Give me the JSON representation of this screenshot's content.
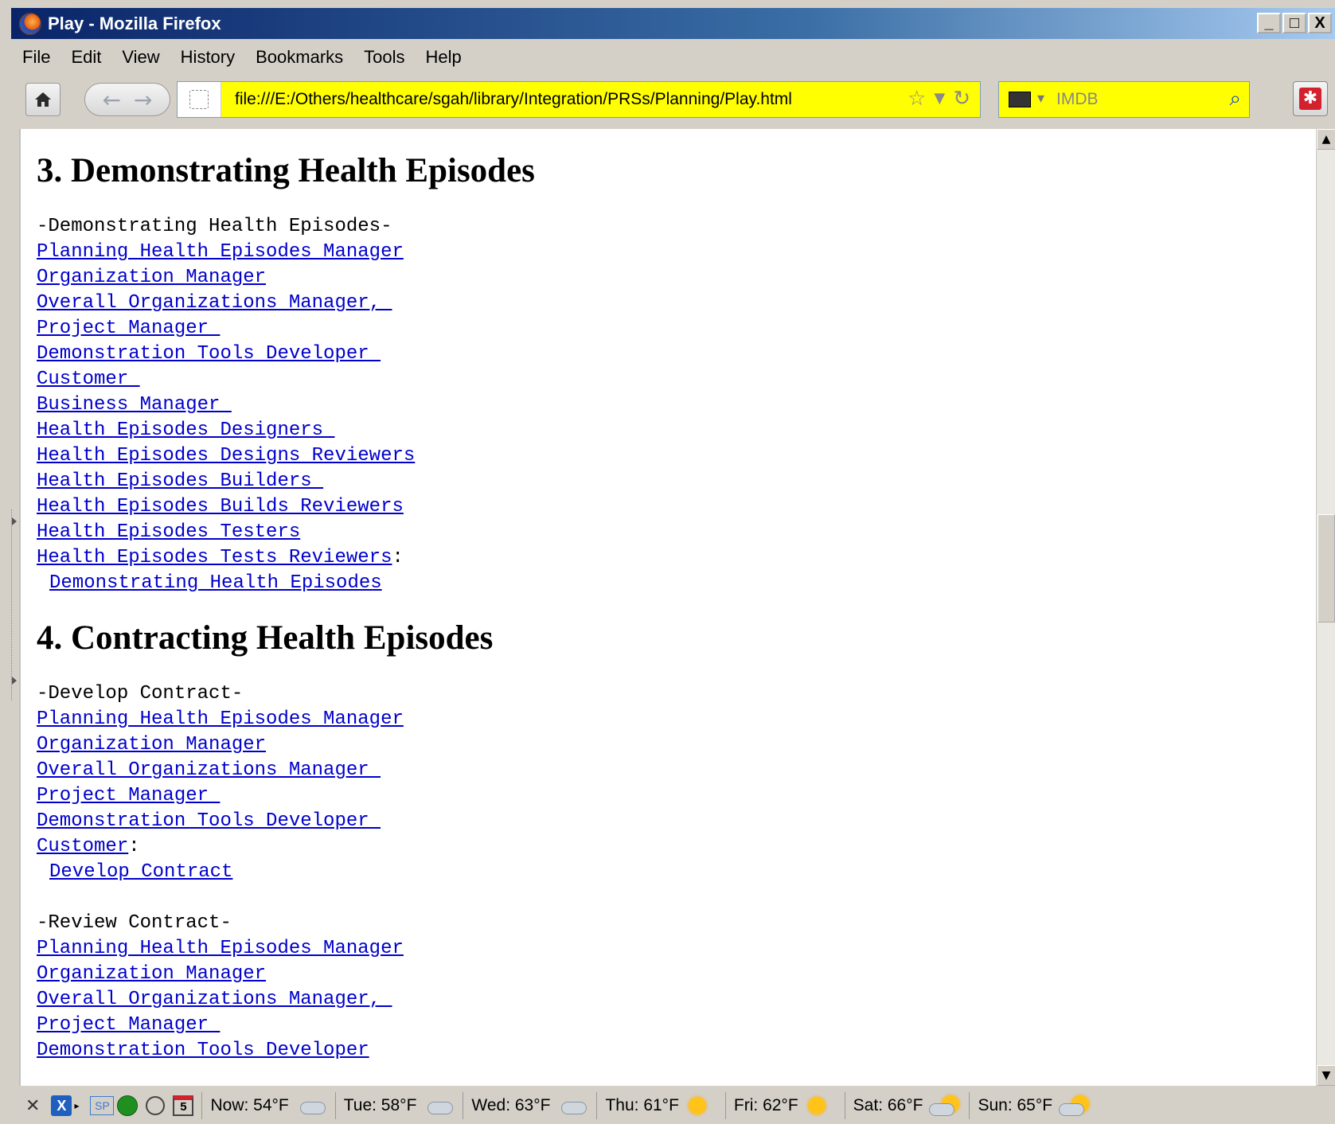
{
  "window": {
    "title": "Play - Mozilla Firefox",
    "controls": {
      "minimize": "_",
      "maximize": "□",
      "close": "X"
    }
  },
  "menubar": {
    "items": [
      "File",
      "Edit",
      "View",
      "History",
      "Bookmarks",
      "Tools",
      "Help"
    ]
  },
  "navbar": {
    "url": "file:///E:/Others/healthcare/sgah/library/Integration/PRSs/Planning/Play.html",
    "search_placeholder": "IMDB"
  },
  "page": {
    "sections": [
      {
        "heading": "3. Demonstrating Health Episodes",
        "groups": [
          {
            "title": "-Demonstrating Health Episodes-",
            "roles": [
              "Planning Health Episodes Manager",
              "Organization Manager",
              "Overall Organizations Manager, ",
              "Project Manager ",
              "Demonstration Tools Developer ",
              "Customer ",
              "Business Manager ",
              "Health Episodes Designers ",
              "Health Episodes Designs Reviewers",
              "Health Episodes Builders ",
              "Health Episodes Builds Reviewers",
              "Health Episodes Testers",
              "Health Episodes Tests Reviewers"
            ],
            "separator": ":",
            "task": "Demonstrating Health Episodes"
          }
        ]
      },
      {
        "heading": "4. Contracting Health Episodes",
        "groups": [
          {
            "title": "-Develop Contract-",
            "roles": [
              "Planning Health Episodes Manager",
              "Organization Manager",
              "Overall Organizations Manager ",
              "Project Manager ",
              "Demonstration Tools Developer ",
              "Customer"
            ],
            "separator": ":",
            "task": "Develop Contract"
          },
          {
            "title": "-Review Contract-",
            "roles": [
              "Planning Health Episodes Manager",
              "Organization Manager",
              "Overall Organizations Manager, ",
              "Project Manager ",
              "Demonstration Tools Developer"
            ]
          }
        ]
      }
    ]
  },
  "statusbar": {
    "calendar_day": "5",
    "sp_label": "SP",
    "weather": [
      {
        "label": "Now: 54°F",
        "icon": "cloud-icon"
      },
      {
        "label": "Tue: 58°F",
        "icon": "rain-cloud-icon"
      },
      {
        "label": "Wed: 63°F",
        "icon": "rain-cloud-icon"
      },
      {
        "label": "Thu: 61°F",
        "icon": "sun-icon"
      },
      {
        "label": "Fri: 62°F",
        "icon": "sun-icon"
      },
      {
        "label": "Sat: 66°F",
        "icon": "partly-cloudy-icon"
      },
      {
        "label": "Sun: 65°F",
        "icon": "partly-cloudy-icon"
      }
    ]
  }
}
